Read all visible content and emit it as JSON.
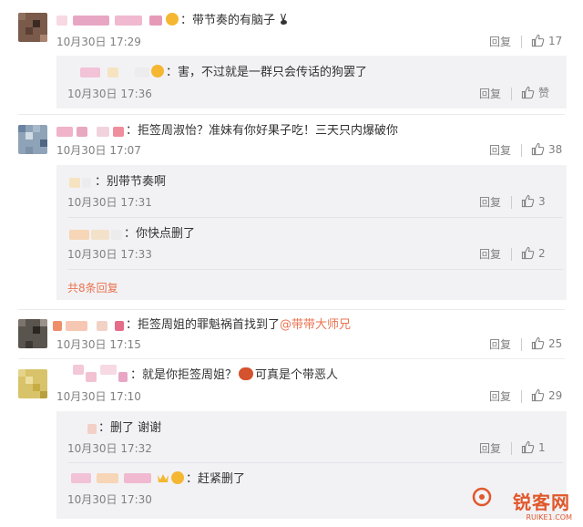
{
  "comments": [
    {
      "text": "：带节奏的有脑子",
      "time": "10月30日 17:29",
      "reply": "回复",
      "likes": "17",
      "replies": [
        {
          "text": "：害，不过就是一群只会传话的狗罢了",
          "time": "10月30日 17:36",
          "reply": "回复",
          "likes": "赞"
        }
      ]
    },
    {
      "text": "：拒签周淑怡？准妹有你好果子吃！三天只内爆破你",
      "time": "10月30日 17:07",
      "reply": "回复",
      "likes": "38",
      "replies": [
        {
          "text": "：别带节奏啊",
          "time": "10月30日 17:31",
          "reply": "回复",
          "likes": "3"
        },
        {
          "text": "：你快点删了",
          "time": "10月30日 17:33",
          "reply": "回复",
          "likes": "2"
        }
      ],
      "more": "共8条回复"
    },
    {
      "text": "：拒签周姐的罪魁祸首找到了",
      "mention": "@带带大师兄",
      "time": "10月30日 17:15",
      "reply": "回复",
      "likes": "25"
    },
    {
      "text": "：就是你拒签周姐？",
      "text2": "可真是个带恶人",
      "time": "10月30日 17:10",
      "reply": "回复",
      "likes": "29",
      "replies": [
        {
          "text": "：删了 谢谢",
          "time": "10月30日 17:32",
          "reply": "回复",
          "likes": "1"
        },
        {
          "text": "：赶紧删了",
          "time": "10月30日 17:30",
          "reply": "回复",
          "likes": ""
        }
      ]
    }
  ],
  "watermark": {
    "text": "锐客网",
    "sub": "RUIKE1.COM"
  },
  "colors": {
    "link": "#eb7350",
    "muted": "#808080",
    "subbox": "#f2f2f5"
  },
  "icons": {
    "like": "thumbs-up-icon",
    "emoji": "smile-emoji-icon",
    "crown": "crown-icon"
  }
}
